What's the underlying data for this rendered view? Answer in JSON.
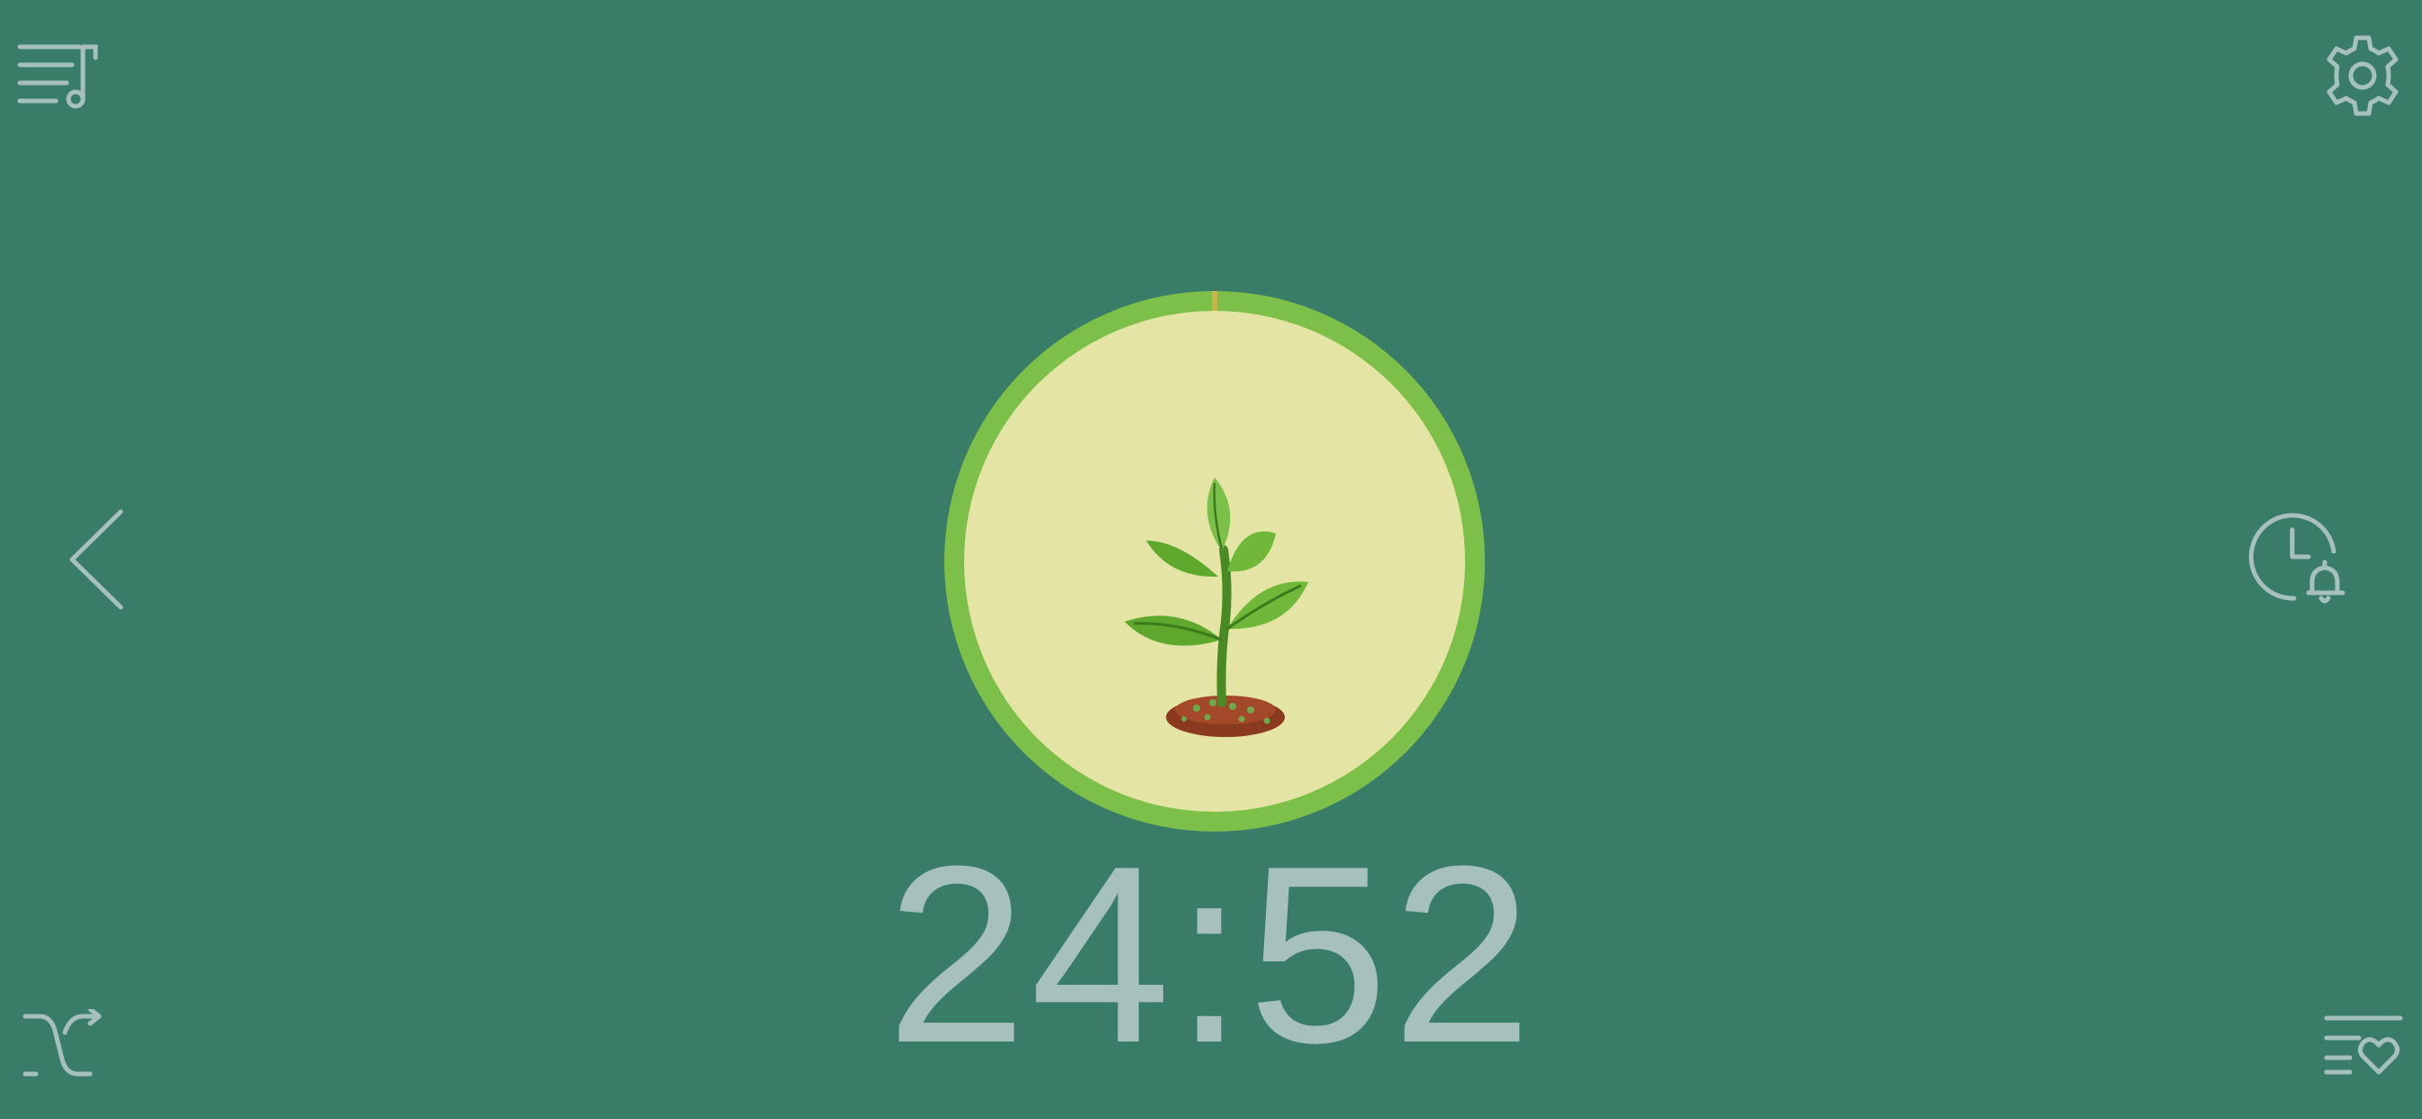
{
  "app": {
    "background_color": "#397d68",
    "accent_color": "#7cc04a",
    "icon_color": "#a6c0bb"
  },
  "toolbar": {
    "top_left_icon": "playlist-music-icon",
    "top_right_icon": "settings-gear-icon",
    "left_icon": "chevron-left-icon",
    "right_icon": "clock-alarm-icon",
    "bottom_left_icon": "shuffle-icon",
    "bottom_right_icon": "favorites-list-icon"
  },
  "timer": {
    "display": "24:52",
    "ring_color": "#7cc04a",
    "ring_inner_color": "#e4e5a5",
    "progress_marker_color": "#c9b64a",
    "illustration": "sprout-plant"
  }
}
